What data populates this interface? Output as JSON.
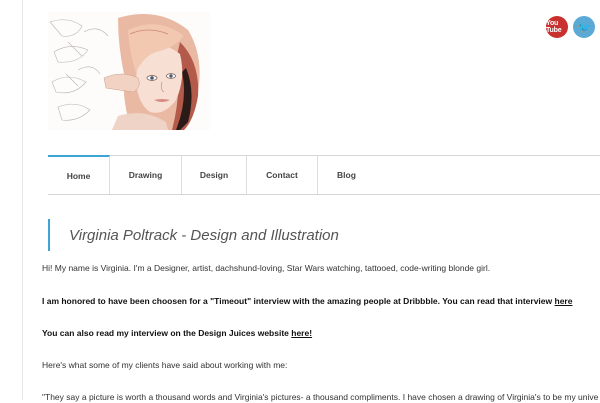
{
  "header": {
    "portrait_alt": "Illustrated portrait",
    "social": [
      {
        "name": "youtube",
        "label": "You Tube"
      },
      {
        "name": "twitter",
        "label": "🐦"
      }
    ]
  },
  "nav": {
    "items": [
      {
        "label": "Home",
        "active": true
      },
      {
        "label": "Drawing",
        "active": false
      },
      {
        "label": "Design",
        "active": false
      },
      {
        "label": "Contact",
        "active": false
      },
      {
        "label": "Blog",
        "active": false
      }
    ]
  },
  "content": {
    "title": "Virginia Poltrack - Design and Illustration",
    "intro": "Hi! My name is Virginia. I'm a Designer, artist, dachshund-loving, Star Wars watching, tattooed, code-writing blonde girl.",
    "timeout_text": "I am honored to have been choosen for a \"Timeout\" interview with the amazing people at Dribbble. You can read that interview ",
    "timeout_link": "here",
    "juices_text": "You can also read my interview on the Design Juices website ",
    "juices_link": "here!",
    "clients_intro": "Here's what some of my clients have said about working with me:",
    "quote": "\"They say a picture is worth a thousand words and Virginia's pictures- a thousand compliments. I have chosen a drawing of Virginia's to be my unive"
  },
  "colors": {
    "accent": "#3ea6d6",
    "youtube": "#c8312d",
    "twitter": "#5aa9d6"
  }
}
